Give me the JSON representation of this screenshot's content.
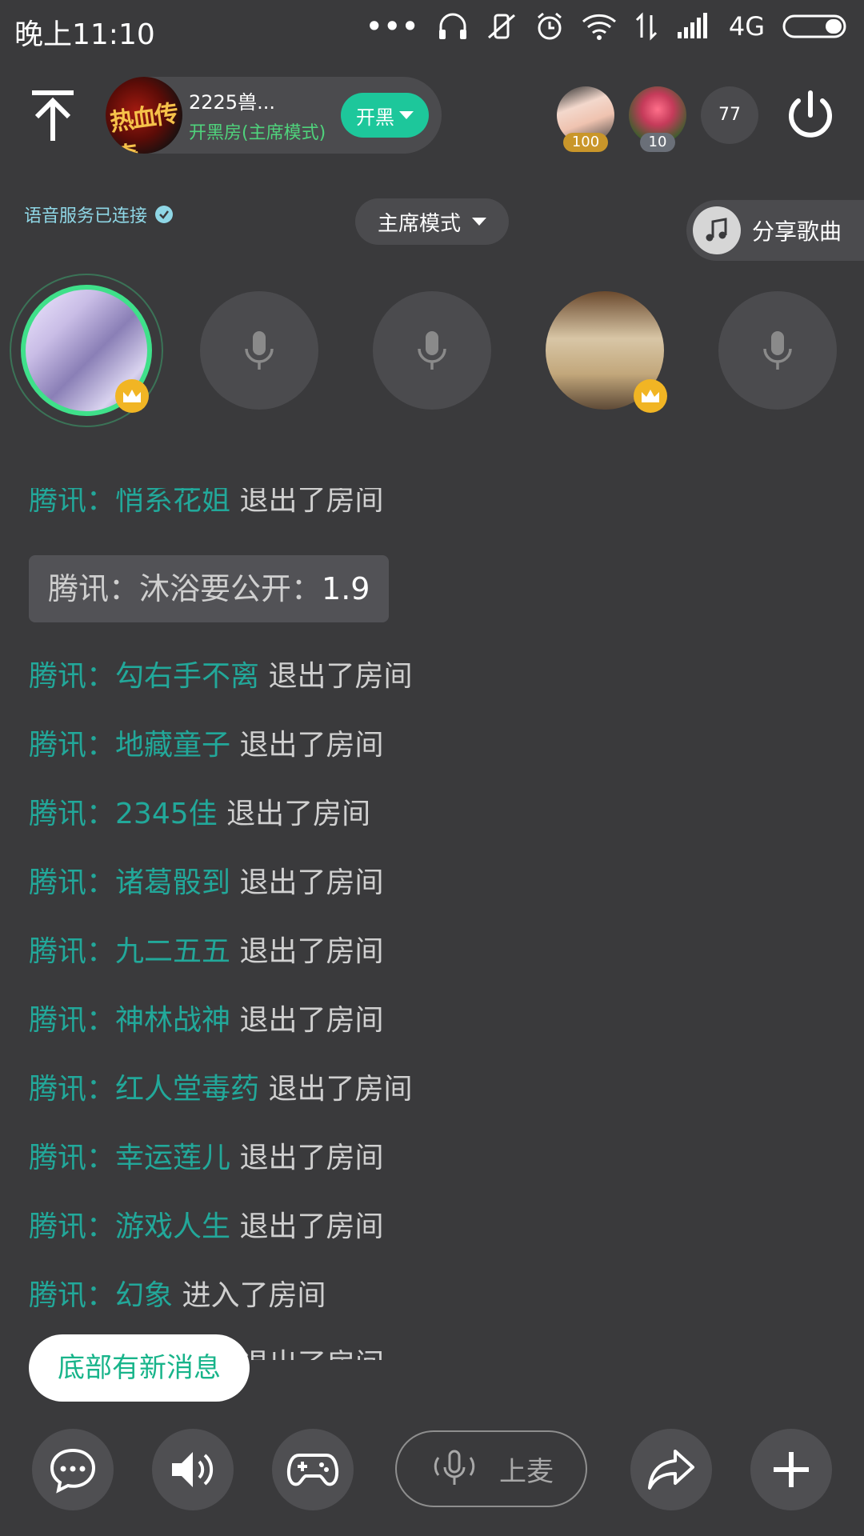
{
  "status_bar": {
    "time": "晚上11:10",
    "network": "4G"
  },
  "header": {
    "room_name": "2225兽...",
    "room_subtitle": "开黑房(主席模式)",
    "mode_button": "开黑",
    "viewers": [
      {
        "badge": "100"
      },
      {
        "badge": "10"
      }
    ],
    "viewer_count": "77"
  },
  "toolbar": {
    "voice_status": "语音服务已连接",
    "chair_mode": "主席模式",
    "share_song": "分享歌曲"
  },
  "chat": {
    "cut_top_line": {
      "source": "腾讯：",
      "user": "悄系花姐",
      "action": " 退出了房间"
    },
    "highlight": {
      "label": "腾讯：沐浴要公开：",
      "value": "1.9"
    },
    "messages": [
      {
        "source": "腾讯：",
        "user": "勾右手不离",
        "action": " 退出了房间"
      },
      {
        "source": "腾讯：",
        "user": "地藏童子",
        "action": " 退出了房间"
      },
      {
        "source": "腾讯：",
        "user": "2345佳",
        "action": " 退出了房间"
      },
      {
        "source": "腾讯：",
        "user": "诸葛骰到",
        "action": " 退出了房间"
      },
      {
        "source": "腾讯：",
        "user": "九二五五",
        "action": " 退出了房间"
      },
      {
        "source": "腾讯：",
        "user": "神林战神",
        "action": " 退出了房间"
      },
      {
        "source": "腾讯：",
        "user": "红人堂毒药",
        "action": " 退出了房间"
      },
      {
        "source": "腾讯：",
        "user": "幸运莲儿",
        "action": " 退出了房间"
      },
      {
        "source": "腾讯：",
        "user": "游戏人生",
        "action": " 退出了房间"
      },
      {
        "source": "腾讯：",
        "user": "幻象",
        "action": " 进入了房间"
      },
      {
        "source": "",
        "user": "",
        "action": "退出了房间"
      }
    ],
    "new_message_toast": "底部有新消息"
  },
  "bottom_bar": {
    "mic_up": "上麦"
  },
  "colors": {
    "background": "#3a3a3c",
    "accent": "#1dc79b",
    "chat_user": "#22a89a",
    "host_ring": "#3fe08a"
  }
}
